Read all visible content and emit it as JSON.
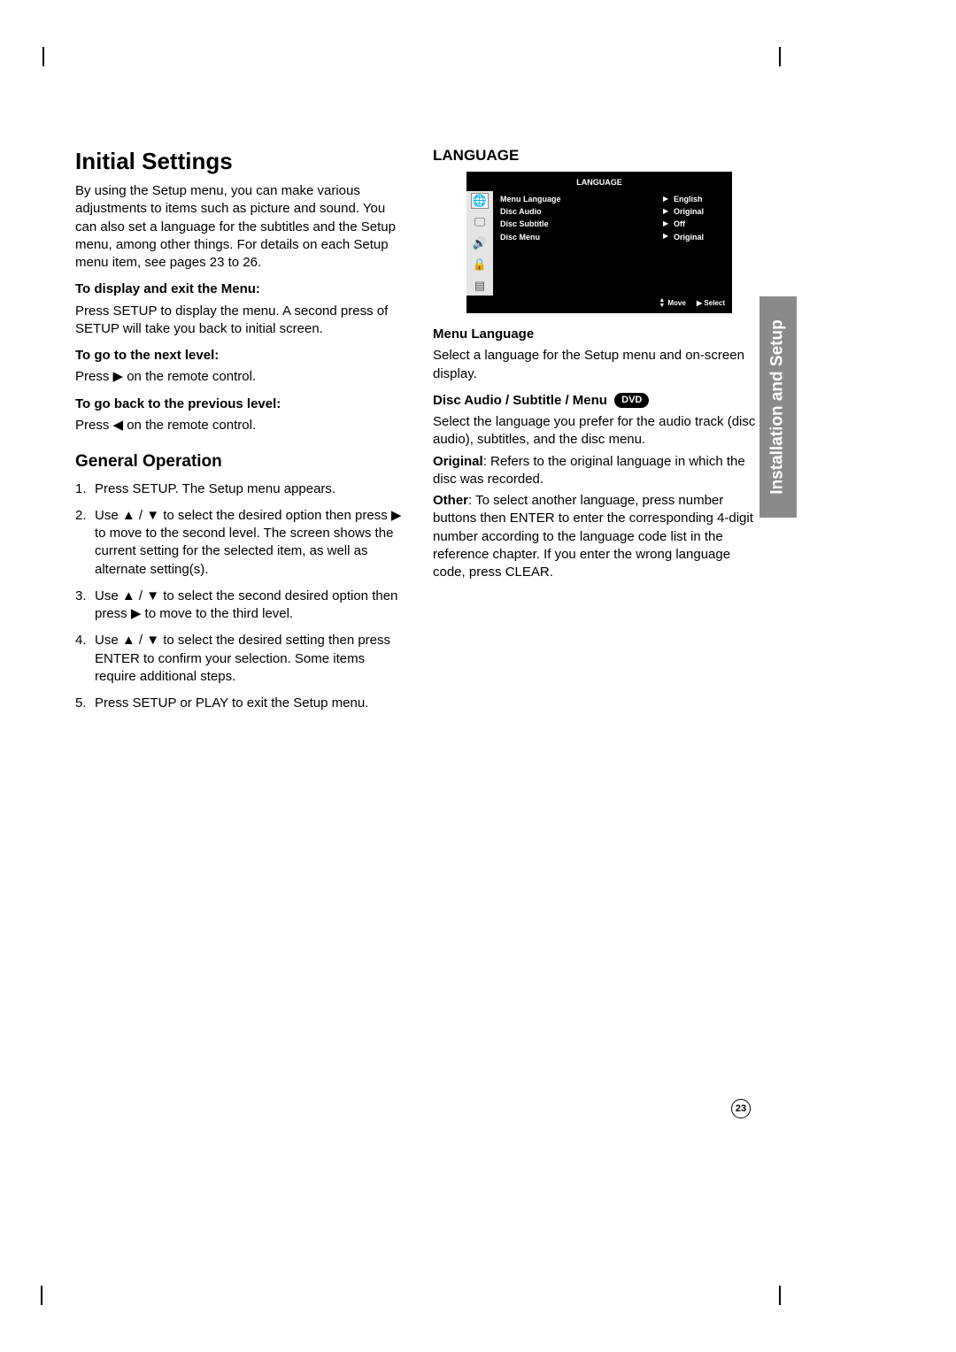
{
  "left": {
    "h1": "Initial Settings",
    "intro": "By using the Setup menu, you can make various adjustments to items such as picture and sound. You can also set a language for the subtitles and the Setup menu, among other things. For details on each Setup menu item, see pages 23 to 26.",
    "display_h": "To display and exit the Menu:",
    "display_p": "Press SETUP to display the menu. A second press of SETUP will take you back to initial screen.",
    "next_h": "To go to the next level:",
    "next_p": "Press ▶ on the remote control.",
    "back_h": "To go back to the previous level:",
    "back_p": "Press ◀ on the remote control.",
    "genop_h": "General Operation",
    "steps": [
      "Press SETUP. The Setup menu appears.",
      "Use ▲ / ▼ to select the desired option then press ▶ to move to the second level. The screen shows the current setting for the selected item, as well as alternate setting(s).",
      "Use ▲ / ▼ to select the second desired option then press ▶ to move to the third level.",
      "Use ▲ / ▼ to select the desired setting then press ENTER to confirm your selection. Some items require additional steps.",
      "Press SETUP or PLAY to exit the Setup menu."
    ]
  },
  "right": {
    "h2": "LANGUAGE",
    "osd": {
      "title": "LANGUAGE",
      "rows": [
        {
          "label": "Menu Language",
          "value": "English"
        },
        {
          "label": "Disc Audio",
          "value": "Original"
        },
        {
          "label": "Disc Subtitle",
          "value": "Off"
        },
        {
          "label": "Disc Menu",
          "value": "Original"
        }
      ],
      "foot_move": "Move",
      "foot_select": "Select"
    },
    "menu_lang_h": "Menu Language",
    "menu_lang_p": "Select a language for the Setup menu and on-screen display.",
    "das_h": "Disc Audio / Subtitle / Menu",
    "das_badge": "DVD",
    "das_p": "Select the language you prefer for the audio track (disc audio), subtitles, and the disc menu.",
    "original_b": "Original",
    "original_p": ": Refers to the original language in which the disc was recorded.",
    "other_b": "Other",
    "other_p": ": To select another language, press number buttons then ENTER to enter the corresponding 4-digit number according to the language code list in the reference chapter. If you enter the wrong language code, press CLEAR."
  },
  "side_tab": "Installation and Setup",
  "page_number": "23"
}
